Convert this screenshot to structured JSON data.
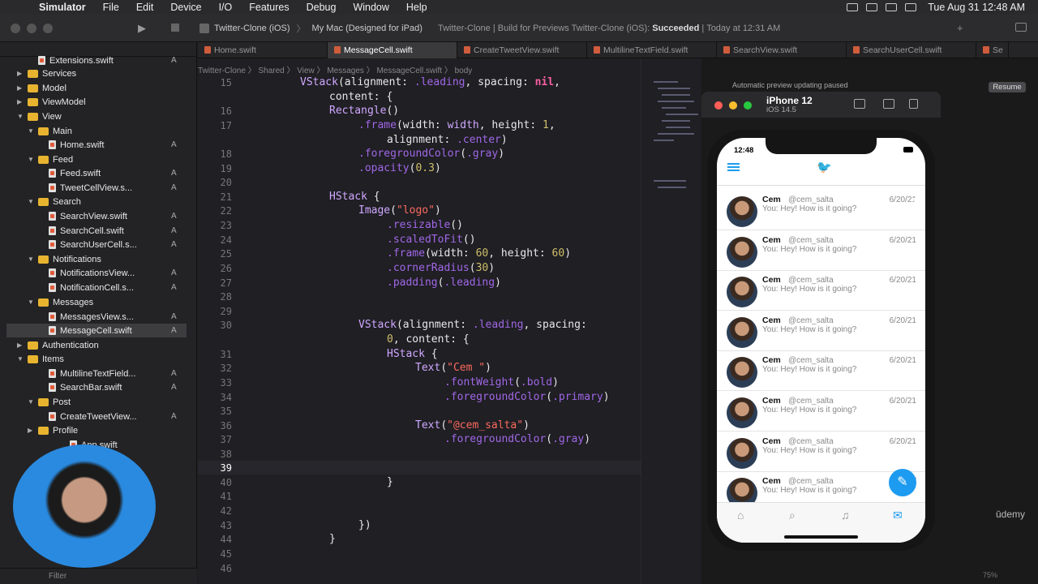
{
  "menubar": {
    "app": "Simulator",
    "items": [
      "File",
      "Edit",
      "Device",
      "I/O",
      "Features",
      "Debug",
      "Window",
      "Help"
    ],
    "clock": "Tue Aug 31  12:48 AM"
  },
  "toolbar": {
    "scheme": "Twitter-Clone (iOS)",
    "destination": "My Mac (Designed for iPad)",
    "status_prefix": "Twitter-Clone | Build for Previews Twitter-Clone (iOS):",
    "status_bold": "Succeeded",
    "status_time": "Today at 12:31 AM"
  },
  "tabs": [
    "Home.swift",
    "MessageCell.swift",
    "CreateTweetView.swift",
    "MultilineTextField.swift",
    "SearchView.swift",
    "SearchUserCell.swift",
    "Se"
  ],
  "breadcrumb": "Twitter-Clone  〉 Shared 〉 View 〉 Messages 〉 MessageCell.swift 〉 body",
  "sidebar": {
    "filter_placeholder": "Filter",
    "items": [
      {
        "label": "Extensions.swift",
        "flag": "A"
      },
      {
        "label": "Services",
        "flag": ""
      },
      {
        "label": "Model",
        "flag": ""
      },
      {
        "label": "ViewModel",
        "flag": ""
      },
      {
        "label": "View",
        "flag": ""
      },
      {
        "label": "Main",
        "flag": ""
      },
      {
        "label": "Home.swift",
        "flag": "A"
      },
      {
        "label": "Feed",
        "flag": ""
      },
      {
        "label": "Feed.swift",
        "flag": "A"
      },
      {
        "label": "TweetCellView.s...",
        "flag": "A"
      },
      {
        "label": "Search",
        "flag": ""
      },
      {
        "label": "SearchView.swift",
        "flag": "A"
      },
      {
        "label": "SearchCell.swift",
        "flag": "A"
      },
      {
        "label": "SearchUserCell.s...",
        "flag": "A"
      },
      {
        "label": "Notifications",
        "flag": ""
      },
      {
        "label": "NotificationsView...",
        "flag": "A"
      },
      {
        "label": "NotificationCell.s...",
        "flag": "A"
      },
      {
        "label": "Messages",
        "flag": ""
      },
      {
        "label": "MessagesView.s...",
        "flag": "A"
      },
      {
        "label": "MessageCell.swift",
        "flag": "A"
      },
      {
        "label": "Authentication",
        "flag": ""
      },
      {
        "label": "Items",
        "flag": ""
      },
      {
        "label": "MultilineTextField...",
        "flag": "A"
      },
      {
        "label": "SearchBar.swift",
        "flag": "A"
      },
      {
        "label": "Post",
        "flag": ""
      },
      {
        "label": "CreateTweetView...",
        "flag": "A"
      },
      {
        "label": "Profile",
        "flag": ""
      },
      {
        "label": "App.swift",
        "flag": ""
      }
    ]
  },
  "code": {
    "line_numbers": [
      "15",
      "16",
      "17",
      "18",
      "19",
      "20",
      "21",
      "22",
      "23",
      "24",
      "25",
      "26",
      "27",
      "28",
      "29",
      "30",
      "31",
      "32",
      "33",
      "34",
      "35",
      "36",
      "37",
      "38",
      "39",
      "40",
      "41",
      "42",
      "43",
      "44",
      "45",
      "46"
    ]
  },
  "preview": {
    "banner": "Automatic preview updating paused",
    "resume": "Resume",
    "device": "iPhone 12",
    "os": "iOS 14.5"
  },
  "phone": {
    "time": "12:48",
    "rows": [
      {
        "name": "Cem",
        "handle": "@cem_salta",
        "date": "6/20/21",
        "message": "You: Hey! How is it going?"
      },
      {
        "name": "Cem",
        "handle": "@cem_salta",
        "date": "6/20/21",
        "message": "You: Hey! How is it going?"
      },
      {
        "name": "Cem",
        "handle": "@cem_salta",
        "date": "6/20/21",
        "message": "You: Hey! How is it going?"
      },
      {
        "name": "Cem",
        "handle": "@cem_salta",
        "date": "6/20/21",
        "message": "You: Hey! How is it going?"
      },
      {
        "name": "Cem",
        "handle": "@cem_salta",
        "date": "6/20/21",
        "message": "You: Hey! How is it going?"
      },
      {
        "name": "Cem",
        "handle": "@cem_salta",
        "date": "6/20/21",
        "message": "You: Hey! How is it going?"
      },
      {
        "name": "Cem",
        "handle": "@cem_salta",
        "date": "6/20/21",
        "message": "You: Hey! How is it going?"
      },
      {
        "name": "Cem",
        "handle": "@cem_salta",
        "date": "6/",
        "message": "You: Hey! How is it going?"
      }
    ]
  },
  "watermark": "ūdemy",
  "zoom": "75%",
  "icons": {
    "apple": "apple-icon",
    "bird": "twitter-bird-icon",
    "hamburger": "hamburger-menu-icon",
    "compose": "compose-icon",
    "home": "home-icon",
    "search": "search-icon",
    "bell": "bell-icon",
    "mail": "mail-icon"
  }
}
